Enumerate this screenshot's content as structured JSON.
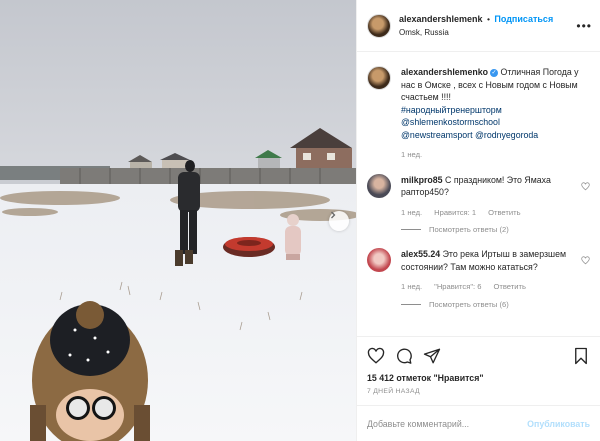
{
  "colors": {
    "accent": "#0095f6",
    "link": "#00376b",
    "muted": "#8e8e8e",
    "publish_disabled": "#b2dffc"
  },
  "header": {
    "username": "alexandershlemenk",
    "separator": "•",
    "follow_label": "Подписаться",
    "location": "Omsk, Russia",
    "more_icon": "more-horizontal-icon"
  },
  "caption": {
    "username": "alexandershlemenko",
    "text": "Отличная Погода у нас в Омске , всех с Новым годом с Новым счастьем !!!!",
    "hashtag": "#народныйтренершторм",
    "mention1": "@shlemenkostormschool",
    "mention2": "@newstreamsport",
    "mention3": "@rodnyegoroda",
    "time": "1 нед."
  },
  "comments": [
    {
      "username": "milkpro85",
      "text": "С праздником! Это Ямаха раптор450?",
      "time": "1 нед.",
      "likes": "Нравится: 1",
      "reply": "Ответить",
      "replies": "Посмотреть ответы (2)"
    },
    {
      "username": "alex55.24",
      "text": "Это река Иртыш в замерзшем состоянии? Там можно кататься?",
      "time": "1 нед.",
      "likes": "\"Нравится\": 6",
      "reply": "Ответить",
      "replies": "Посмотреть ответы (6)"
    }
  ],
  "actions": {
    "icons": [
      "heart-icon",
      "comment-icon",
      "share-icon",
      "bookmark-icon"
    ],
    "likes": "15 412 отметок \"Нравится\"",
    "date": "7 ДНЕЙ НАЗАД"
  },
  "add_comment": {
    "placeholder": "Добавьте комментарий...",
    "publish_label": "Опубликовать"
  }
}
